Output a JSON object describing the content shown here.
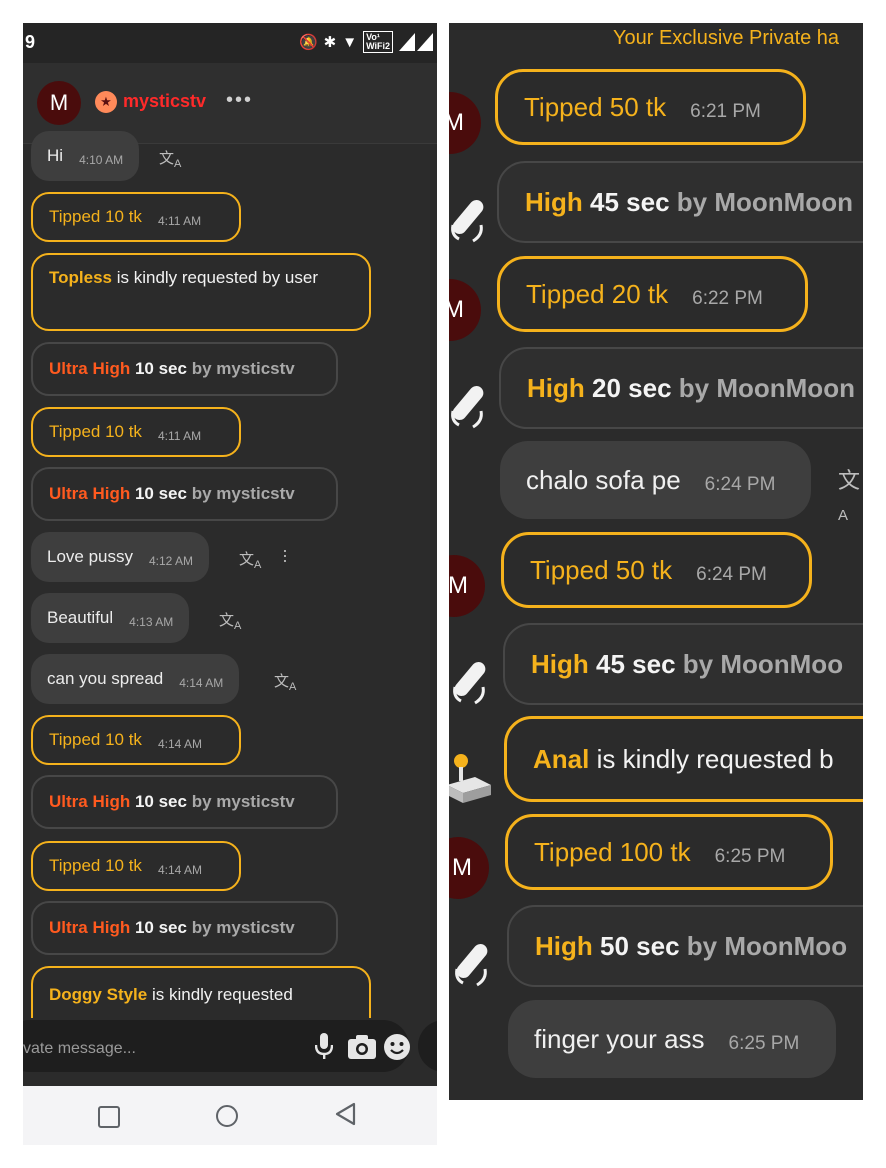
{
  "status_bar": {
    "time": "9",
    "wifi_badge_top": "Vo¹",
    "wifi_badge_bottom": "WiFi2"
  },
  "chat_header": {
    "avatar_letter": "M",
    "username": "mysticstv",
    "more": "•••"
  },
  "left_messages": {
    "m1": {
      "text": "Hi",
      "time": "4:10 AM"
    },
    "m2": {
      "text": "Tipped 10 tk",
      "time": "4:11 AM"
    },
    "m3": {
      "highlight": "Topless",
      "rest": " is kindly requested by user"
    },
    "m4": {
      "level": "Ultra High",
      "duration": "10 sec",
      "by": "by",
      "user": "mysticstv"
    },
    "m5": {
      "text": "Tipped 10 tk",
      "time": "4:11 AM"
    },
    "m6": {
      "level": "Ultra High",
      "duration": "10 sec",
      "by": "by",
      "user": "mysticstv"
    },
    "m7": {
      "text": "Love pussy",
      "time": "4:12 AM"
    },
    "m8": {
      "text": "Beautiful",
      "time": "4:13 AM"
    },
    "m9": {
      "text": "can you spread",
      "time": "4:14 AM"
    },
    "m10": {
      "text": "Tipped 10 tk",
      "time": "4:14 AM"
    },
    "m11": {
      "level": "Ultra High",
      "duration": "10 sec",
      "by": "by",
      "user": "mysticstv"
    },
    "m12": {
      "text": "Tipped 10 tk",
      "time": "4:14 AM"
    },
    "m13": {
      "level": "Ultra High",
      "duration": "10 sec",
      "by": "by",
      "user": "mysticstv"
    },
    "m14": {
      "highlight": "Doggy Style",
      "rest": " is kindly requested"
    }
  },
  "translate_glyph": "文",
  "translate_a": "A",
  "input": {
    "placeholder": "vate message..."
  },
  "right_banner": "Your Exclusive Private ha",
  "right_messages": {
    "r1": {
      "avatar": "M",
      "text": "Tipped 50 tk",
      "time": "6:21 PM"
    },
    "r2": {
      "level": "High",
      "duration": "45 sec",
      "by": "by",
      "user": "MoonMoon"
    },
    "r3": {
      "avatar": "M",
      "text": "Tipped 20 tk",
      "time": "6:22 PM"
    },
    "r4": {
      "level": "High",
      "duration": "20 sec",
      "by": "by",
      "user": "MoonMoon"
    },
    "r5": {
      "text": "chalo sofa pe",
      "time": "6:24 PM"
    },
    "r6": {
      "avatar": "M",
      "text": "Tipped 50 tk",
      "time": "6:24 PM"
    },
    "r7": {
      "level": "High",
      "duration": "45 sec",
      "by": "by",
      "user": "MoonMoo"
    },
    "r8": {
      "highlight": "Anal",
      "rest": " is kindly requested b"
    },
    "r9": {
      "avatar": "M",
      "text": "Tipped 100 tk",
      "time": "6:25 PM"
    },
    "r10": {
      "level": "High",
      "duration": "50 sec",
      "by": "by",
      "user": "MoonMoo"
    },
    "r11": {
      "text": "finger your ass",
      "time": "6:25 PM"
    }
  },
  "colors": {
    "tip_gold": "#f5b21c",
    "ultra_high": "#ff5a1f",
    "username_red": "#ff2a2a",
    "panel_bg": "#2b2b2b"
  }
}
